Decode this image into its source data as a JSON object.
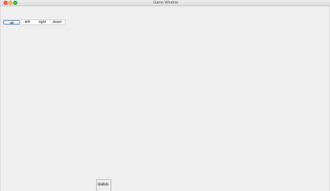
{
  "window": {
    "title": "Game Window"
  },
  "controls": {
    "buttons": [
      {
        "label": "up",
        "selected": true
      },
      {
        "label": "left",
        "selected": false
      },
      {
        "label": "right",
        "selected": false
      },
      {
        "label": "down",
        "selected": false
      }
    ]
  },
  "status": {
    "label": "status"
  },
  "colors": {
    "close": "#fc5f57",
    "minimize": "#fdbc2e",
    "maximize": "#28c840",
    "focus_ring": "#6a8ccf"
  }
}
